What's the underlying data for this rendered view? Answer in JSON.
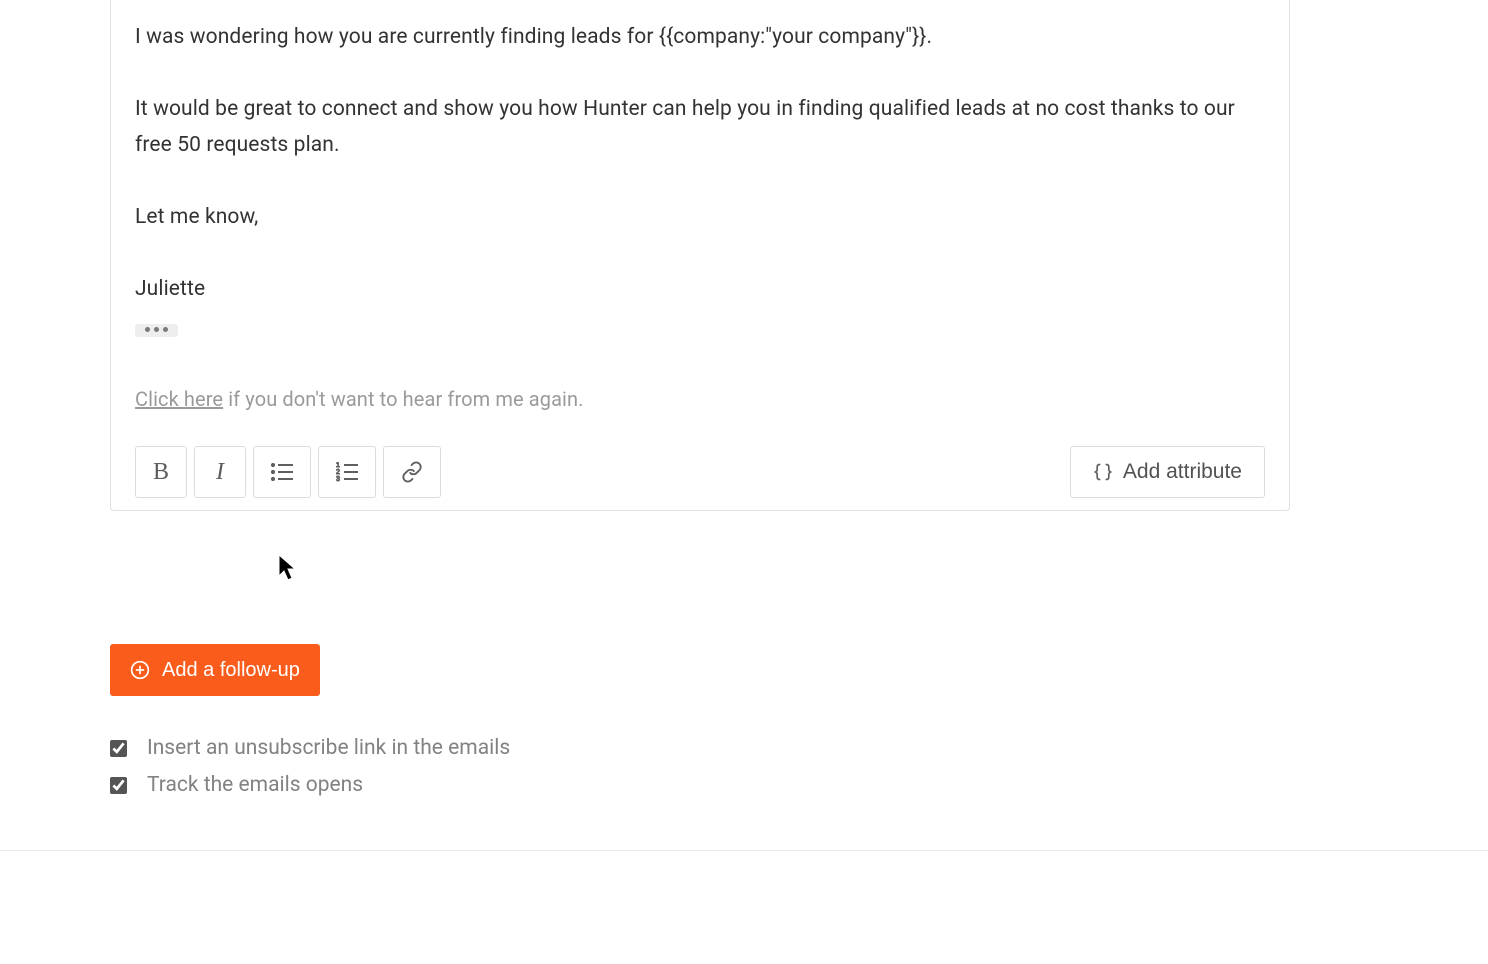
{
  "email_body": {
    "line1": "I was wondering how you are currently finding leads for {{company:\"your company\"}}.",
    "line2": "It would be great to connect and show you how Hunter can help you in finding qualified leads at no cost thanks to our free 50 requests plan.",
    "line3": "Let me know,",
    "signature": "Juliette"
  },
  "unsubscribe": {
    "link_text": "Click here",
    "rest": " if you don't want to hear from me again."
  },
  "toolbar": {
    "add_attribute_label": "Add attribute"
  },
  "add_followup_label": "Add a follow-up",
  "options": {
    "unsubscribe": {
      "checked": true,
      "label": "Insert an unsubscribe link in the emails"
    },
    "track_opens": {
      "checked": true,
      "label": "Track the emails opens"
    }
  }
}
